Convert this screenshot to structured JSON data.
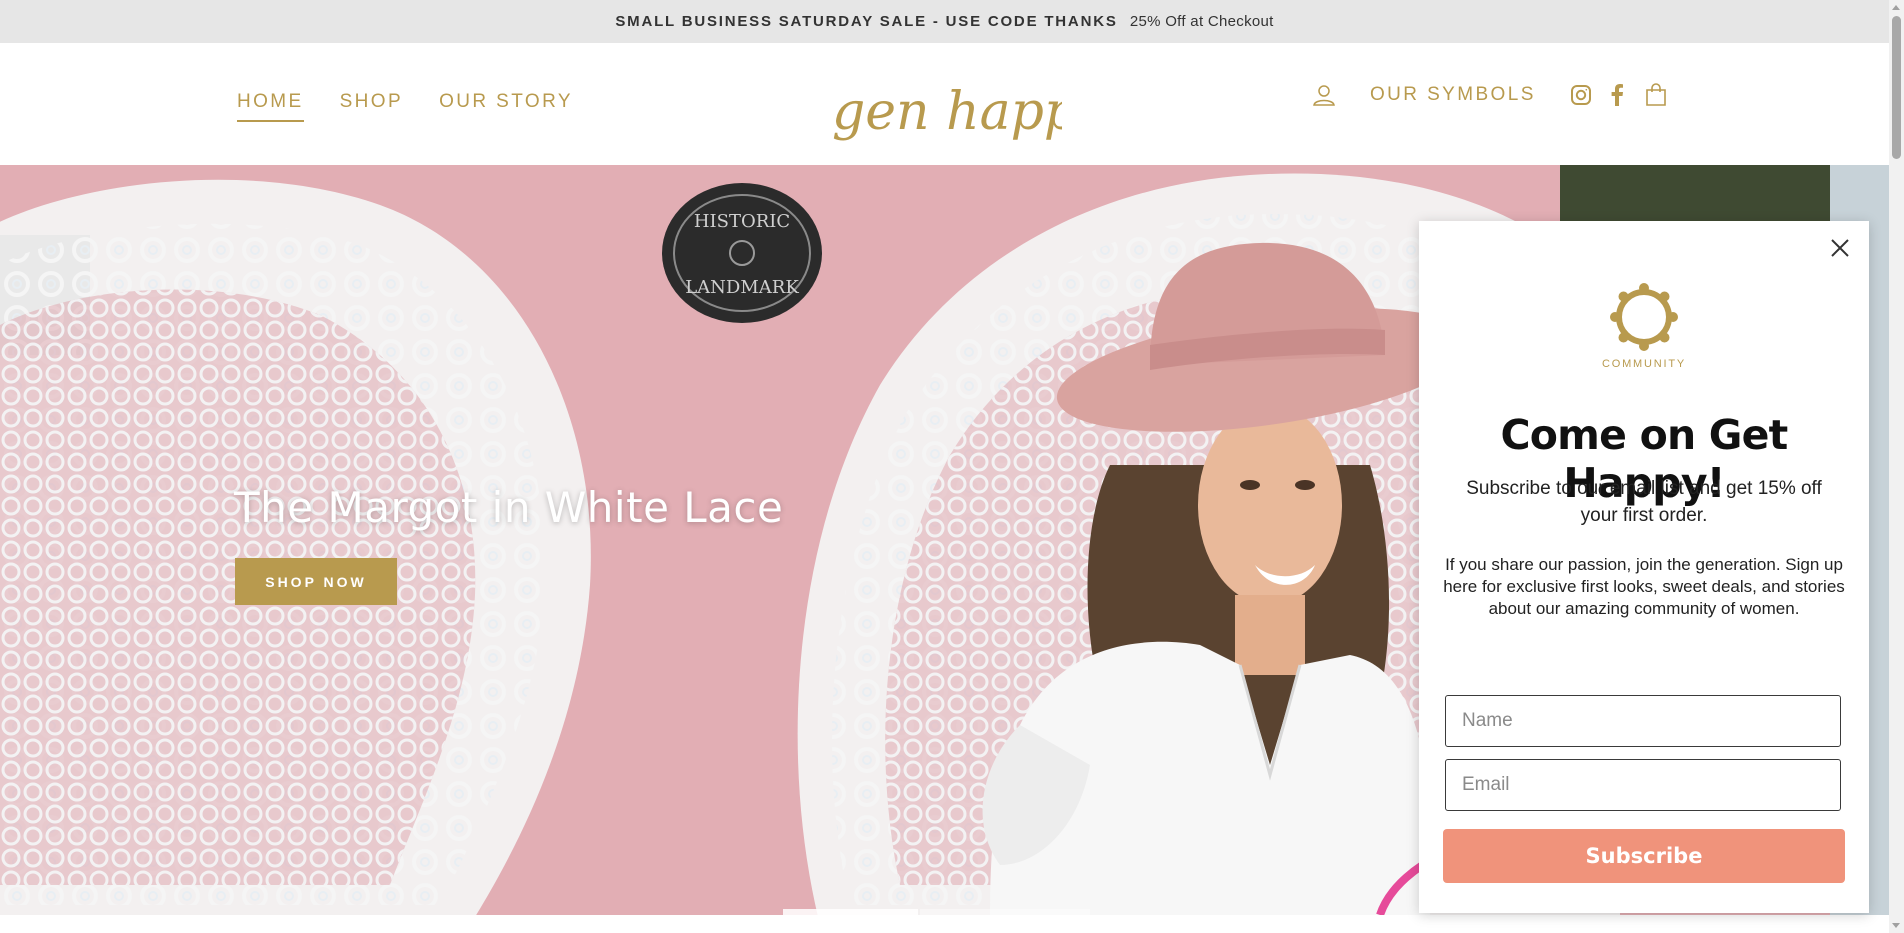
{
  "announcement": {
    "highlight": "SMALL BUSINESS SATURDAY SALE - USE CODE THANKS",
    "detail": "25% Off at Checkout"
  },
  "header": {
    "nav_left": [
      {
        "label": "HOME",
        "active": true
      },
      {
        "label": "SHOP",
        "active": false
      },
      {
        "label": "OUR STORY",
        "active": false
      }
    ],
    "logo_text": "gen happy",
    "symbols_label": "OUR SYMBOLS",
    "icons": [
      "account-icon",
      "instagram-icon",
      "facebook-icon",
      "cart-icon"
    ]
  },
  "hero": {
    "title": "The Margot in White Lace",
    "cta_label": "SHOP NOW",
    "plaque_line1": "HISTORIC",
    "plaque_line2": "LANDMARK"
  },
  "popup": {
    "badge_label": "COMMUNITY",
    "title": "Come on Get Happy!",
    "subtitle": "Subscribe to our email list and get 15% off your first order.",
    "body": "If you share our passion, join the generation. Sign up here for exclusive first looks, sweet deals, and stories about our amazing community of women.",
    "name_placeholder": "Name",
    "email_placeholder": "Email",
    "subscribe_label": "Subscribe"
  },
  "colors": {
    "brand_gold": "#b89a4e",
    "subscribe_coral": "#f0937b",
    "announcement_bg": "#e6e6e6",
    "hero_wall_pink": "#e2aeb4"
  }
}
